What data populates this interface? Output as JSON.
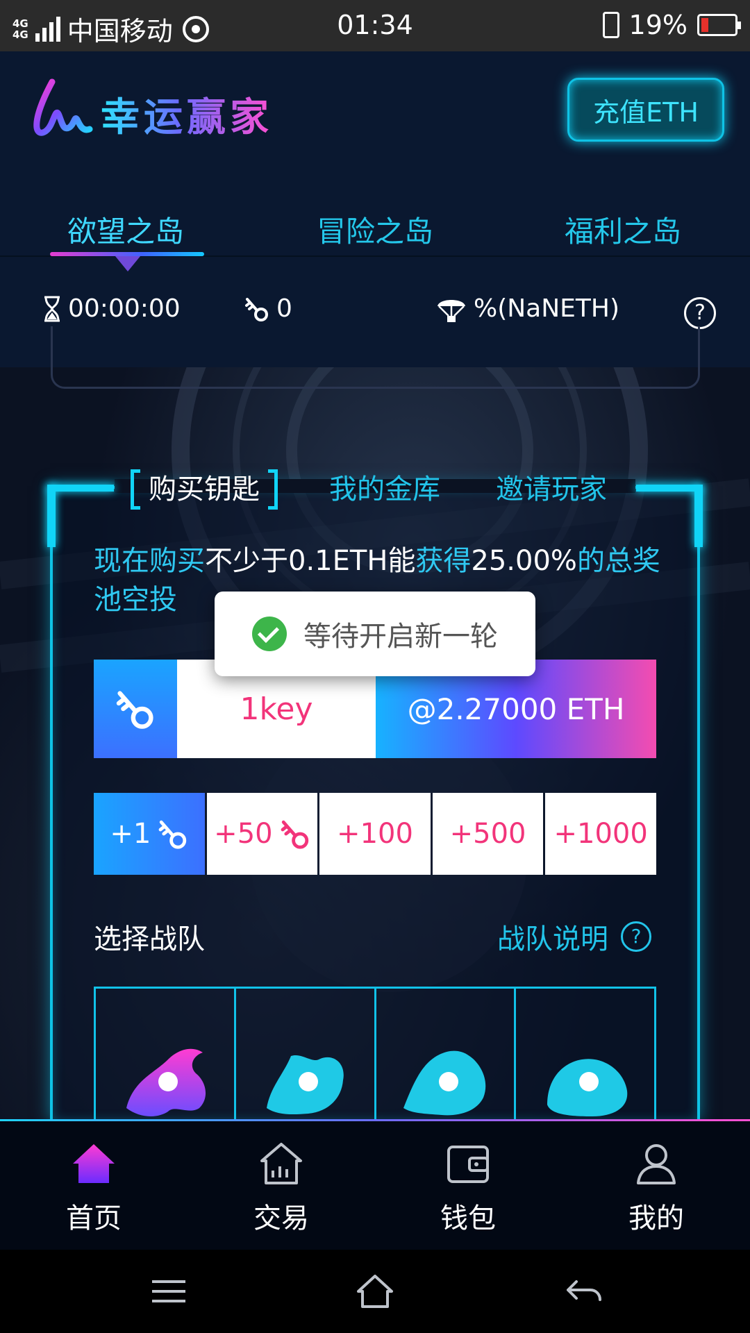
{
  "status_bar": {
    "net1": "4G",
    "net2": "4G",
    "carrier": "中国移动",
    "time": "01:34",
    "battery": "19%"
  },
  "header": {
    "logo_text": "lw",
    "title": "幸运赢家",
    "recharge_label": "充值ETH"
  },
  "island_tabs": [
    {
      "label": "欲望之岛",
      "active": true
    },
    {
      "label": "冒险之岛",
      "active": false
    },
    {
      "label": "福利之岛",
      "active": false
    }
  ],
  "stats": {
    "timer": "00:00:00",
    "keys": "0",
    "airdrop": "%(NaNETH)",
    "help": "?"
  },
  "panel": {
    "tabs": [
      "购买钥匙",
      "我的金库",
      "邀请玩家"
    ],
    "desc_1": "现在购买",
    "desc_2": "不少于0.1ETH能",
    "desc_3": "获得",
    "desc_4": "25.00%",
    "desc_5": "的总奖池空投",
    "quantity": "1key",
    "price": "@2.27000 ETH",
    "add_buttons": [
      "+1",
      "+50",
      "+100",
      "+500",
      "+1000"
    ],
    "team_label": "选择战队",
    "team_help": "战队说明",
    "team_help_q": "?"
  },
  "toast": {
    "message": "等待开启新一轮"
  },
  "bottom_nav": [
    {
      "label": "首页",
      "icon": "home-icon",
      "active": true
    },
    {
      "label": "交易",
      "icon": "market-icon",
      "active": false
    },
    {
      "label": "钱包",
      "icon": "wallet-icon",
      "active": false
    },
    {
      "label": "我的",
      "icon": "user-icon",
      "active": false
    }
  ],
  "colors": {
    "accent_cyan": "#0fc3e6",
    "accent_pink": "#f2347a",
    "toast_success": "#3db54a"
  }
}
